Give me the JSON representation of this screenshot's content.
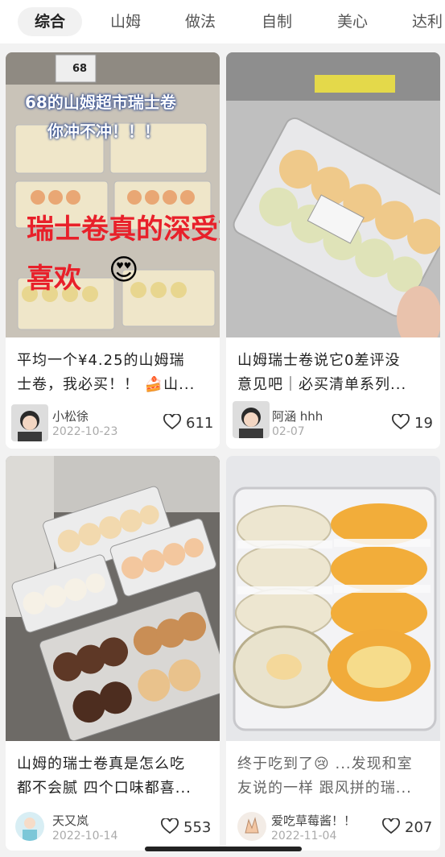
{
  "tabs": [
    "综合",
    "山姆",
    "做法",
    "自制",
    "美心",
    "达利"
  ],
  "cards": [
    {
      "overlay_top": "68的山姆超市瑞士卷",
      "overlay_sub": "你冲不冲！！！",
      "overlay_big1": "瑞士卷真的深受姐妹们",
      "overlay_big2": "喜欢",
      "price_tag": "68",
      "emoji": "😍",
      "title_line1": "平均一个¥4.25的山姆瑞",
      "title_line2": "士卷，我必买！！ 🍰山...",
      "author": "小松徐",
      "date": "2022-10-23",
      "likes": "611"
    },
    {
      "title_line1": "山姆瑞士卷说它0差评没",
      "title_line2": "意见吧｜必买清单系列...",
      "author": "阿涵 hhh",
      "date": "02-07",
      "likes": "19"
    },
    {
      "title_line1": "山姆的瑞士卷真是怎么吃",
      "title_line2": "都不会腻 四个口味都喜...",
      "author": "天又岚",
      "date": "2022-10-14",
      "likes": "553"
    },
    {
      "title_line1": "终于吃到了😢 ...发现和室",
      "title_line2": "友说的一样 跟风拼的瑞...",
      "author": "爱吃草莓酱！！",
      "date": "2022-11-04",
      "likes": "207"
    }
  ],
  "colors": {
    "accent_red": "#e8202a",
    "heart": "#333333",
    "bg": "#f2f2f2"
  }
}
